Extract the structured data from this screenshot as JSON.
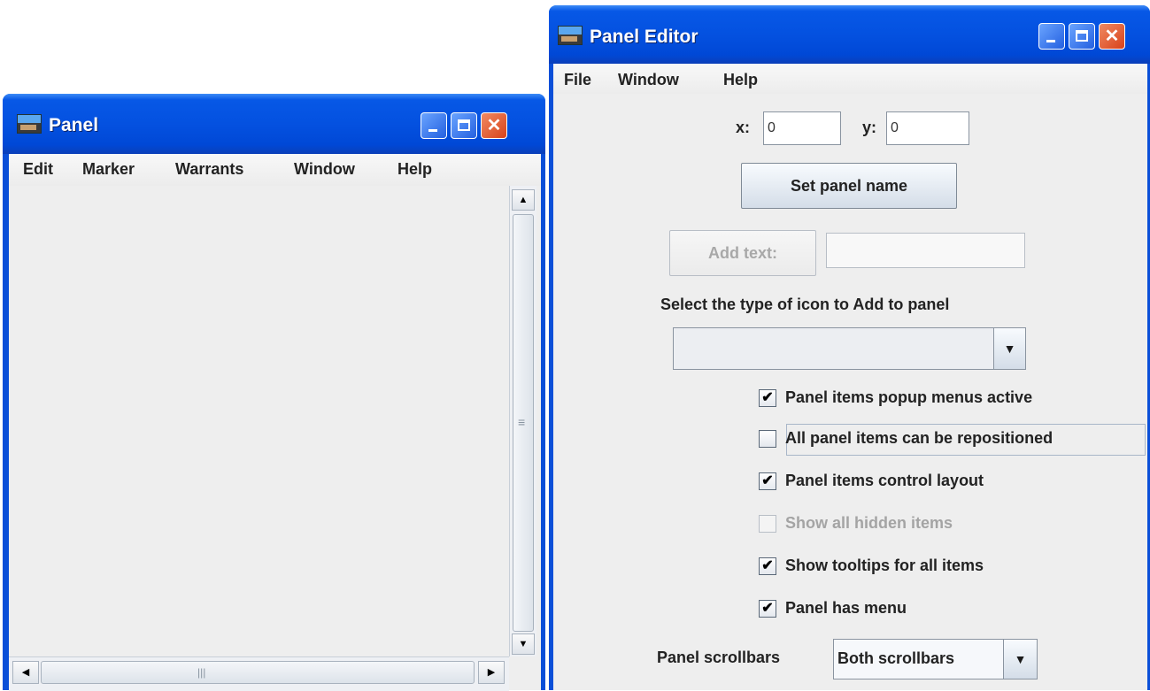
{
  "panel_window": {
    "title": "Panel",
    "menu": [
      "Edit",
      "Marker",
      "Warrants",
      "Window",
      "Help"
    ],
    "vscroll": {
      "up": "▲",
      "down": "▼",
      "grip": "≡"
    },
    "hscroll": {
      "left": "◀",
      "right": "▶",
      "grip": "|||"
    },
    "icons": [
      "panel-app-icon",
      "minimize-icon",
      "maximize-icon",
      "close-icon"
    ]
  },
  "editor_window": {
    "title": "Panel Editor",
    "menu": [
      "File",
      "Window",
      "Help"
    ],
    "x_label": "x:",
    "x_value": "0",
    "y_label": "y:",
    "y_value": "0",
    "set_panel_name": "Set panel name",
    "add_text": "Add text:",
    "add_text_value": "",
    "icon_type_label": "Select the type of icon to Add to panel",
    "icon_type_value": "",
    "checkboxes": [
      {
        "label": "Panel items popup menus active",
        "checked": "✔",
        "enabled": true
      },
      {
        "label": "All panel items can be repositioned",
        "checked": "",
        "enabled": true
      },
      {
        "label": "Panel items control layout",
        "checked": "✔",
        "enabled": true
      },
      {
        "label": "Show all hidden items",
        "checked": "",
        "enabled": false
      },
      {
        "label": "Show tooltips for all items",
        "checked": "✔",
        "enabled": true
      },
      {
        "label": "Panel has menu",
        "checked": "✔",
        "enabled": true
      }
    ],
    "scrollbars_label": "Panel scrollbars",
    "scrollbars_value": "Both scrollbars",
    "combo_arrow": "▼"
  },
  "window_buttons": {
    "close_glyph": "✕"
  },
  "colors": {
    "titlebar": "#0451e0",
    "close_button": "#d8421a",
    "client": "#eeeeee"
  }
}
